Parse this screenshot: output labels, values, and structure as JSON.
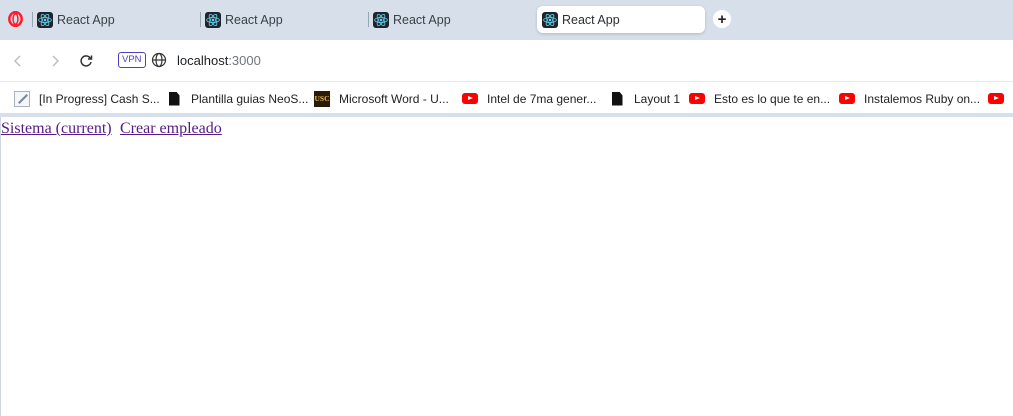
{
  "browser": {
    "tabs": [
      {
        "title": "React App",
        "active": false
      },
      {
        "title": "React App",
        "active": false
      },
      {
        "title": "React App",
        "active": false
      },
      {
        "title": "React App",
        "active": true
      }
    ],
    "new_tab_label": "+",
    "address": {
      "vpn_label": "VPN",
      "host": "localhost",
      "port": ":3000"
    },
    "bookmarks": [
      {
        "label": "[In Progress] Cash S...",
        "icon": "pencil-doc-icon"
      },
      {
        "label": "Plantilla guias NeoS...",
        "icon": "document-icon"
      },
      {
        "label": "Microsoft Word - U...",
        "icon": "usc-logo-icon"
      },
      {
        "label": "Intel de 7ma gener...",
        "icon": "youtube-icon"
      },
      {
        "label": "Layout 1",
        "icon": "document-icon"
      },
      {
        "label": "Esto es lo que te en...",
        "icon": "youtube-icon"
      },
      {
        "label": "Instalemos Ruby on...",
        "icon": "youtube-icon"
      }
    ],
    "usc_logo_text": "USC",
    "colors": {
      "tabstrip": "#d7e0ea",
      "opera_red": "#ff1b2d",
      "vpn": "#4b3fbf",
      "visited_link": "#551a8b",
      "youtube": "#ff0000"
    }
  },
  "page": {
    "links": [
      {
        "text": "Sistema (current)"
      },
      {
        "text": "Crear empleado"
      }
    ]
  }
}
